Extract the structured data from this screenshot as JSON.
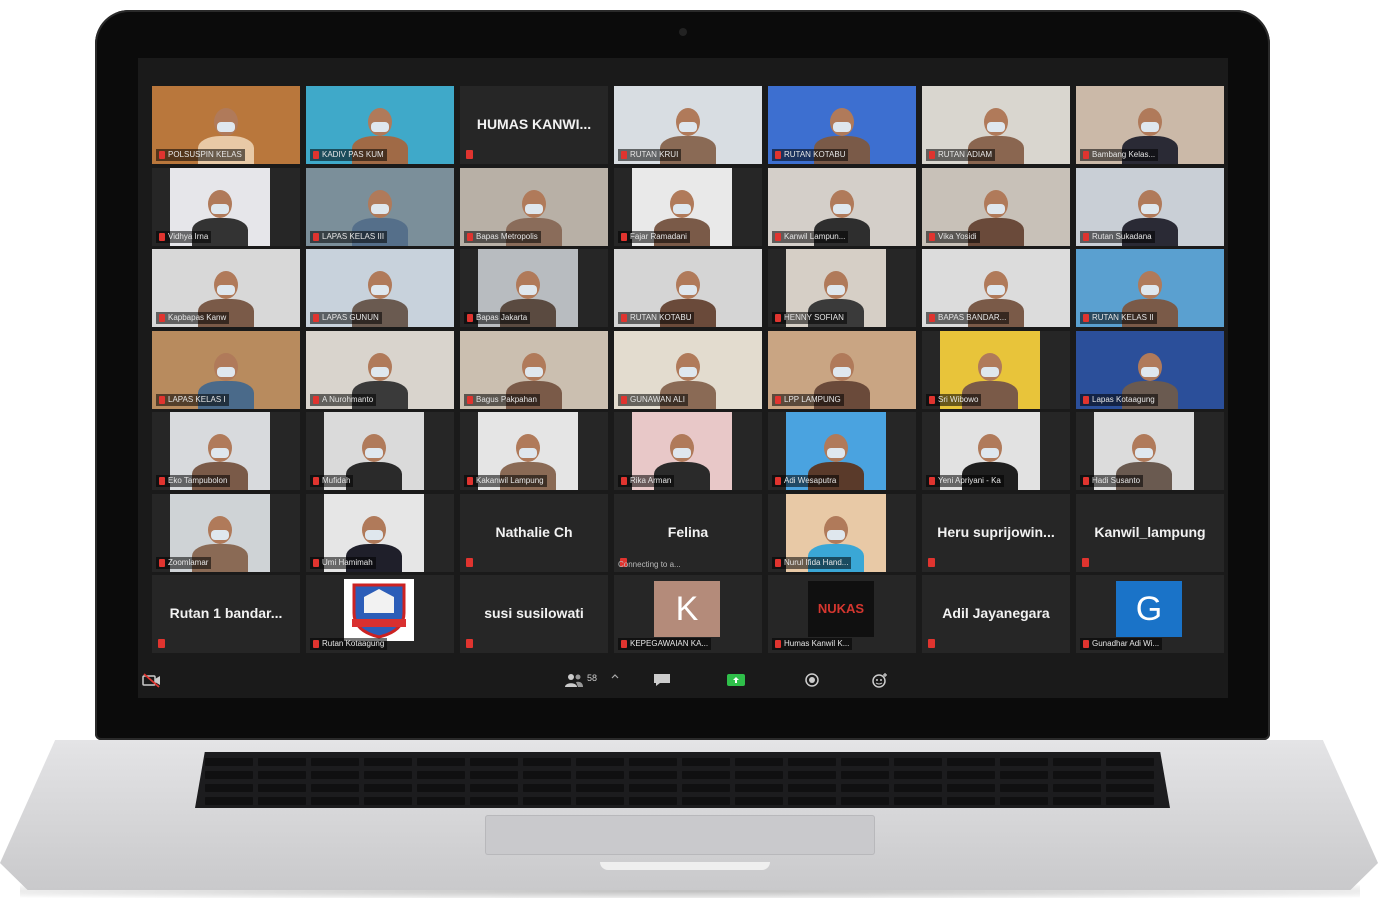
{
  "meeting": {
    "participant_count": "58",
    "rows": [
      [
        {
          "label": "POLSUSPIN KELAS",
          "type": "video",
          "bg": "#b9773c",
          "tone": "#e8c9a6",
          "active": true
        },
        {
          "label": "KADIV PAS KUM",
          "type": "video",
          "bg": "#3fa9c9",
          "tone": "#a06a46"
        },
        {
          "name": "HUMAS  KANWI...",
          "type": "name"
        },
        {
          "label": "RUTAN KRUI",
          "type": "video",
          "bg": "#d8dde2",
          "tone": "#8a6a55"
        },
        {
          "label": "RUTAN KOTABU",
          "type": "video",
          "bg": "#3d6fd0",
          "tone": "#7a5a48"
        },
        {
          "label": "RUTAN ADIAM",
          "type": "video",
          "bg": "#d9d6cf",
          "tone": "#8a6650"
        },
        {
          "label": "Bambang Kelas...",
          "type": "video",
          "bg": "#cbb9a8",
          "tone": "#2a2a35"
        }
      ],
      [
        {
          "label": "Vidhya Irna",
          "type": "video",
          "bg": "#e6e6ea",
          "tone": "#333333",
          "narrow": true
        },
        {
          "label": "LAPAS KELAS III",
          "type": "video",
          "bg": "#7b8f9a",
          "tone": "#556f8a"
        },
        {
          "label": "Bapas Metropolis",
          "type": "video",
          "bg": "#b8b0a6",
          "tone": "#8a6c5a"
        },
        {
          "label": "Fajar Ramadani",
          "type": "video",
          "bg": "#e9e9e9",
          "tone": "#7a5a48",
          "narrow": true
        },
        {
          "label": "Kanwil Lampun...",
          "type": "video",
          "bg": "#d4cfc9",
          "tone": "#2e2e2e"
        },
        {
          "label": "Vika Yosidi",
          "type": "video",
          "bg": "#c8c1b8",
          "tone": "#6a4a3a"
        },
        {
          "label": "Rutan Sukadana",
          "type": "video",
          "bg": "#c9cfd6",
          "tone": "#2a2a35"
        }
      ],
      [
        {
          "label": "Kapbapas Kanw",
          "type": "video",
          "bg": "#d8d8d8",
          "tone": "#7a5a48"
        },
        {
          "label": "LAPAS GUNUN",
          "type": "video",
          "bg": "#c8d2dc",
          "tone": "#6a5a50"
        },
        {
          "label": "Bapas Jakarta",
          "type": "video",
          "bg": "#b8bcc0",
          "tone": "#5a4a40",
          "narrow": true
        },
        {
          "label": "RUTAN KOTABU",
          "type": "video",
          "bg": "#d5d5d5",
          "tone": "#6a4a3a"
        },
        {
          "label": "HENNY SOFIAN",
          "type": "video",
          "bg": "#d6cfc6",
          "tone": "#3a3a3a",
          "narrow": true
        },
        {
          "label": "BAPAS BANDAR...",
          "type": "video",
          "bg": "#dcdcdc",
          "tone": "#7a5a48"
        },
        {
          "label": "RUTAN KELAS II",
          "type": "video",
          "bg": "#5aa0d0",
          "tone": "#7a5a48"
        }
      ],
      [
        {
          "label": "LAPAS KELAS I",
          "type": "video",
          "bg": "#b88b5e",
          "tone": "#4a6a8a"
        },
        {
          "label": "A Nurohmanto",
          "type": "video",
          "bg": "#d9d4cd",
          "tone": "#3a3a3a"
        },
        {
          "label": "Bagus Pakpahan",
          "type": "video",
          "bg": "#cbbfb0",
          "tone": "#7a5a48"
        },
        {
          "label": "GUNAWAN ALI",
          "type": "video",
          "bg": "#e3dccf",
          "tone": "#8a6a55"
        },
        {
          "label": "LPP LAMPUNG",
          "type": "video",
          "bg": "#c9a583",
          "tone": "#6a4a3a"
        },
        {
          "label": "Sri Wibowo",
          "type": "video",
          "bg": "#e8c43a",
          "tone": "#7a5a48",
          "narrow": true
        },
        {
          "label": "Lapas Kotaagung",
          "type": "video",
          "bg": "#2b4f9a",
          "tone": "#6a5a50"
        }
      ],
      [
        {
          "label": "Eko Tampubolon",
          "type": "video",
          "bg": "#d8dadd",
          "tone": "#7a5a48",
          "narrow": true
        },
        {
          "label": "Mufidah",
          "type": "video",
          "bg": "#dadada",
          "tone": "#2a2a2a",
          "narrow": true
        },
        {
          "label": "Kakanwil Lampung",
          "type": "video",
          "bg": "#e5e5e5",
          "tone": "#8a6a55",
          "narrow": true
        },
        {
          "label": "Rika Arman",
          "type": "video",
          "bg": "#e8c8c8",
          "tone": "#2a2a2a",
          "narrow": true
        },
        {
          "label": "Adi Wesaputra",
          "type": "video",
          "bg": "#4aa3e0",
          "tone": "#5a3a2a",
          "narrow": true
        },
        {
          "label": "Yeni Apriyani - Ka",
          "type": "video",
          "bg": "#e2e2e2",
          "tone": "#1e1e1e",
          "narrow": true
        },
        {
          "label": "Hadi Susanto",
          "type": "video",
          "bg": "#dcdcdc",
          "tone": "#6a5a50",
          "narrow": true
        }
      ],
      [
        {
          "label": "Zoomlamar",
          "type": "video",
          "bg": "#cfd3d6",
          "tone": "#8a6a55",
          "narrow": true
        },
        {
          "label": "Umi Hamimah",
          "type": "video",
          "bg": "#e6e6e6",
          "tone": "#1f1f2a",
          "narrow": true
        },
        {
          "name": "Nathalie Ch",
          "type": "name"
        },
        {
          "name": "Felina",
          "type": "name",
          "sub": "Connecting to a..."
        },
        {
          "label": "Nurul Ifida Hand...",
          "type": "video",
          "bg": "#e8c9a6",
          "tone": "#3aa7d6",
          "narrow": true
        },
        {
          "name": "Heru  suprijowin...",
          "type": "name"
        },
        {
          "name": "Kanwil_lampung",
          "type": "name"
        }
      ],
      [
        {
          "name": "Rutan  1  bandar...",
          "type": "name"
        },
        {
          "label": "Rutan Kotaagung",
          "type": "logo",
          "bg": "#ffffff"
        },
        {
          "name": "susi  susilowati",
          "type": "name"
        },
        {
          "label": "KEPEGAWAIAN KA...",
          "type": "avatar",
          "letter": "K",
          "bg": "#b48b7a"
        },
        {
          "label": "Humas Kanwil K...",
          "type": "nukas",
          "text": "NUKAS",
          "bg": "#101010"
        },
        {
          "name": "Adil  Jayanegara",
          "type": "name"
        },
        {
          "label": "Gunadhar Adi Wi...",
          "type": "avatar",
          "letter": "G",
          "bg": "#1a73c8"
        }
      ]
    ]
  },
  "toolbar": {
    "items": [
      {
        "icon": "video-off-icon"
      },
      {
        "icon": "participants-icon",
        "count": "58"
      },
      {
        "icon": "chat-icon"
      },
      {
        "icon": "share-screen-icon"
      },
      {
        "icon": "record-icon"
      },
      {
        "icon": "reactions-icon"
      }
    ]
  },
  "colors": {
    "active_speaker": "#e8e04a",
    "mic_muted": "#e0342f",
    "share_green": "#2fbf4a"
  }
}
